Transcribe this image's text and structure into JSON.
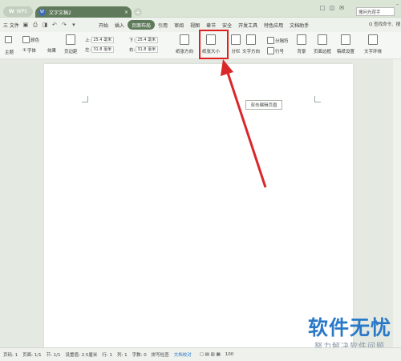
{
  "titlebar": {
    "wps_label": "WPS",
    "doc_tab_label": "文字文稿2",
    "doc_tab_close": "×",
    "new_tab": "+",
    "user_name": "搜问光荏手"
  },
  "menubar": {
    "file_label": "三 文件",
    "items": [
      "开始",
      "插入",
      "页面布局",
      "引用",
      "审阅",
      "视图",
      "章节",
      "安全",
      "开发工具",
      "特色应用",
      "文档助手"
    ],
    "active_index": 2,
    "search_label": "Q 查找命令、搜"
  },
  "ribbon": {
    "theme": "主题",
    "color": "颜色",
    "font": "字体",
    "effect": "效果",
    "margin": "页边距",
    "top_label": "上:",
    "top_value": "25.4 毫米",
    "bottom_label": "下:",
    "bottom_value": "25.4 毫米",
    "left_label": "左:",
    "left_value": "31.8 毫米",
    "right_label": "右:",
    "right_value": "31.8 毫米",
    "orientation": "纸张方向",
    "paper_size": "纸张大小",
    "columns": "分栏",
    "text_direction": "文字方向",
    "line_number": "行号",
    "break": "分隔符",
    "background": "背景",
    "page_border": "页面边框",
    "draft_settings": "稿纸设置",
    "text_wrap": "文字环绕"
  },
  "document": {
    "header_tip": "双击编辑页眉"
  },
  "statusbar": {
    "page_num": "页码: 1",
    "pages": "页面: 1/1",
    "section": "节: 1/1",
    "setting": "设置值: 2.5厘米",
    "row": "行: 1",
    "col": "列: 1",
    "word_count": "字数: 0",
    "spell_check": "拼写检查",
    "doc_check": "文档校对",
    "zoom": "100"
  },
  "watermark": {
    "main": "软件无忧",
    "sub": "努力解决软件问题"
  },
  "colors": {
    "accent": "#5f7a5a",
    "highlight": "#e0201f",
    "watermark": "#2a79c9"
  }
}
